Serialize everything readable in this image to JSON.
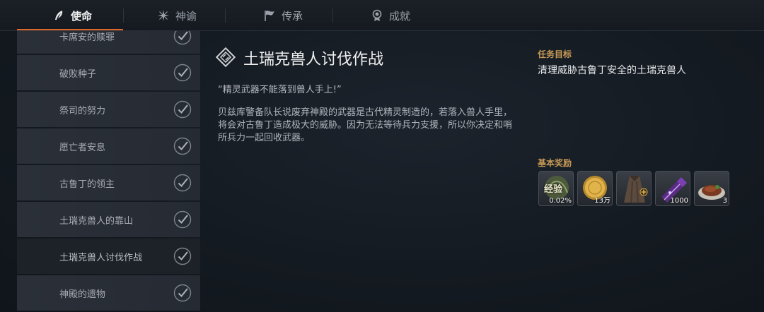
{
  "tabs": [
    {
      "label": "使命",
      "icon": "quill-icon",
      "active": true
    },
    {
      "label": "神谕",
      "icon": "star-burst-icon",
      "active": false
    },
    {
      "label": "传承",
      "icon": "flag-icon",
      "active": false
    },
    {
      "label": "成就",
      "icon": "medal-icon",
      "active": false
    }
  ],
  "quest_list": [
    {
      "label": "卡席安的赎罪",
      "done": true
    },
    {
      "label": "破败种子",
      "done": true
    },
    {
      "label": "祭司的努力",
      "done": true
    },
    {
      "label": "愿亡者安息",
      "done": true
    },
    {
      "label": "古鲁丁的领主",
      "done": true
    },
    {
      "label": "土瑞克兽人的靠山",
      "done": true
    },
    {
      "label": "土瑞克兽人讨伐作战",
      "done": true,
      "selected": true
    },
    {
      "label": "神殿的遗物",
      "done": true
    }
  ],
  "quest": {
    "title": "土瑞克兽人讨伐作战",
    "quote": "“精灵武器不能落到兽人手上!”",
    "description": "贝兹库警备队长说废弃神殿的武器是古代精灵制造的，若落入兽人手里，将会对古鲁丁造成极大的威胁。因为无法等待兵力支援，所以你决定和哨所兵力一起回收武器。"
  },
  "objective": {
    "label": "任务目标",
    "text": "清理威胁古鲁丁安全的土瑞克兽人"
  },
  "rewards": {
    "label": "基本奖励",
    "items": [
      {
        "icon": "experience-icon",
        "icon_text": "经验",
        "qty": "0.02%"
      },
      {
        "icon": "gold-coin-icon",
        "qty": "13万"
      },
      {
        "icon": "cloak-icon",
        "qty": ""
      },
      {
        "icon": "scroll-icon",
        "qty": "1000"
      },
      {
        "icon": "steak-icon",
        "qty": "3"
      }
    ]
  },
  "colors": {
    "accent": "#d9692e",
    "label_gold": "#c89a55"
  }
}
